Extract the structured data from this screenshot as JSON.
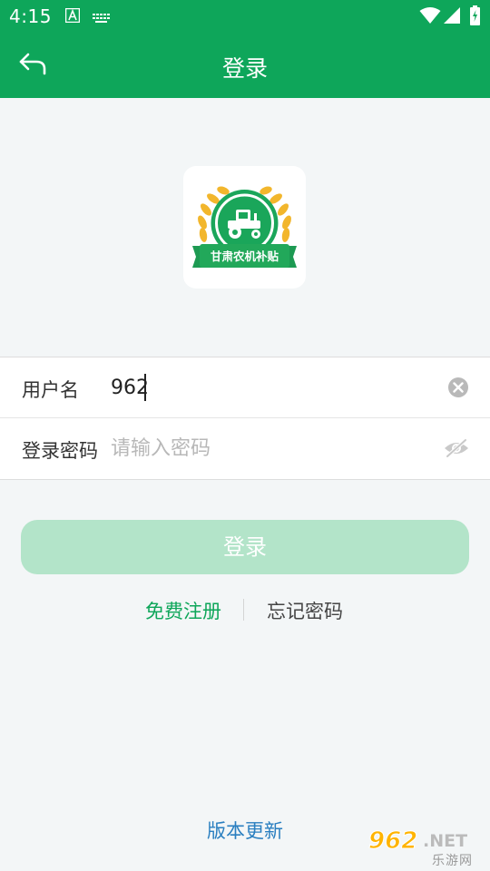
{
  "status_bar": {
    "time": "4:15",
    "icons": [
      "a-badge-icon",
      "keyboard-icon",
      "wifi-icon",
      "signal-icon",
      "battery-icon"
    ]
  },
  "app_bar": {
    "title": "登录",
    "back_icon": "back-arrow-icon"
  },
  "logo": {
    "text": "甘肃农机补贴"
  },
  "form": {
    "username": {
      "label": "用户名",
      "value": "962"
    },
    "password": {
      "label": "登录密码",
      "placeholder": "请输入密码"
    }
  },
  "login_button": {
    "label": "登录"
  },
  "links": {
    "register": "免费注册",
    "forgot": "忘记密码"
  },
  "version_link": "版本更新",
  "watermark": {
    "number": "962",
    "suffix": ".NET",
    "caption": "乐游网"
  },
  "colors": {
    "primary": "#0ea65a",
    "button_disabled": "#b3e4c9",
    "link_blue": "#2a7fc0",
    "background": "#f3f6f7"
  }
}
